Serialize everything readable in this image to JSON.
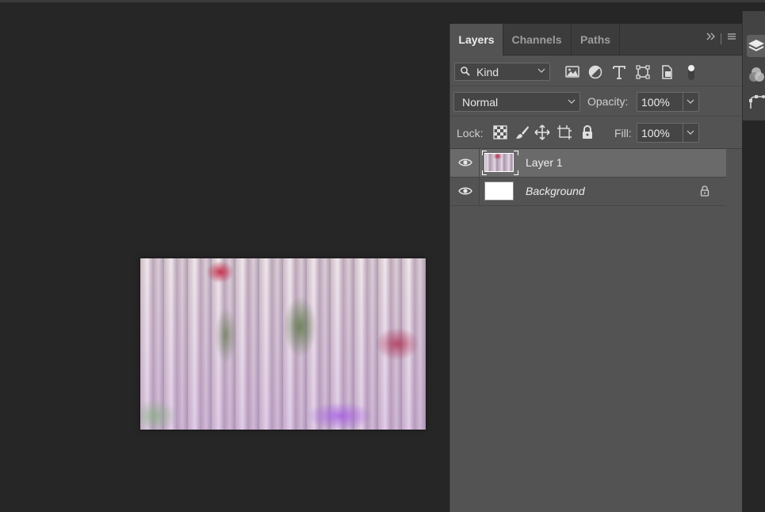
{
  "canvas": {
    "document_image": "layer-1-flower-curtain-image"
  },
  "layers_panel": {
    "tabs": [
      {
        "label": "Layers",
        "active": true
      },
      {
        "label": "Channels",
        "active": false
      },
      {
        "label": "Paths",
        "active": false
      }
    ],
    "filter": {
      "kind_label": "Kind",
      "icons": [
        "image-filter-icon",
        "adjustment-filter-icon",
        "type-filter-icon",
        "shape-filter-icon",
        "smart-object-filter-icon",
        "filter-toggle-icon"
      ]
    },
    "blend_mode": "Normal",
    "opacity_label": "Opacity:",
    "opacity_value": "100%",
    "lock_label": "Lock:",
    "lock_icons": [
      "lock-transparent-pixels-icon",
      "lock-image-pixels-icon",
      "lock-position-icon",
      "lock-artboard-icon",
      "lock-all-icon"
    ],
    "fill_label": "Fill:",
    "fill_value": "100%",
    "layers": [
      {
        "name": "Layer 1",
        "selected": true,
        "visible": true,
        "locked": false
      },
      {
        "name": "Background",
        "selected": false,
        "visible": true,
        "locked": true
      }
    ]
  },
  "side_strip": {
    "icons": [
      "layers-panel-icon",
      "channels-panel-icon",
      "paths-panel-icon"
    ]
  },
  "colors": {
    "canvas_bg": "#262626",
    "panel_bg": "#535353",
    "selected_row": "#6a6a6a"
  }
}
